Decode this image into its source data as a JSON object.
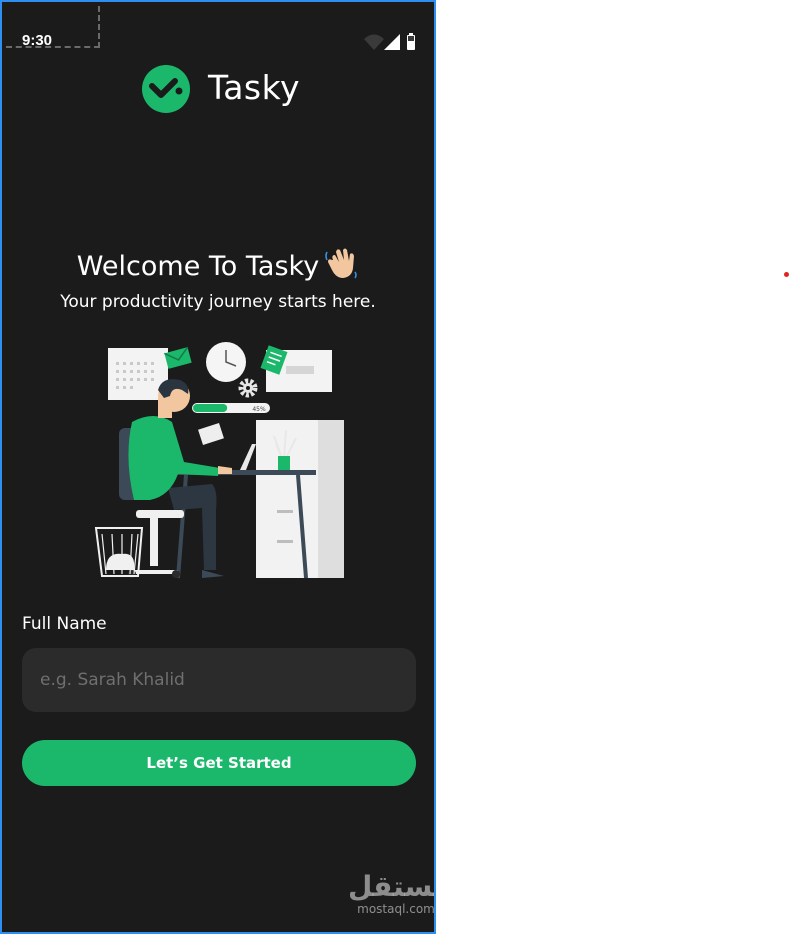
{
  "status_bar": {
    "time": "9:30",
    "icons": [
      "wifi-icon",
      "cellular-signal-icon",
      "battery-icon"
    ]
  },
  "app": {
    "name": "Tasky",
    "logo_icon": "tasky-logo-icon"
  },
  "hero": {
    "title": "Welcome To Tasky",
    "title_emoji": "waving-hand-icon",
    "subtitle": "Your productivity journey starts here.",
    "illustration": "person-working-at-desk-illustration",
    "progress_label": "45%",
    "progress_value": 0.45
  },
  "form": {
    "name_label": "Full Name",
    "name_placeholder": "e.g. Sarah Khalid",
    "name_value": "",
    "submit_label": "Let’s Get Started"
  },
  "watermark": {
    "arabic": "مستقل",
    "latin": "mostaql.com"
  },
  "colors": {
    "background": "#1b1b1b",
    "accent": "#1bb86c",
    "input_bg": "#2b2b2b",
    "frame": "#2e8ff0"
  }
}
